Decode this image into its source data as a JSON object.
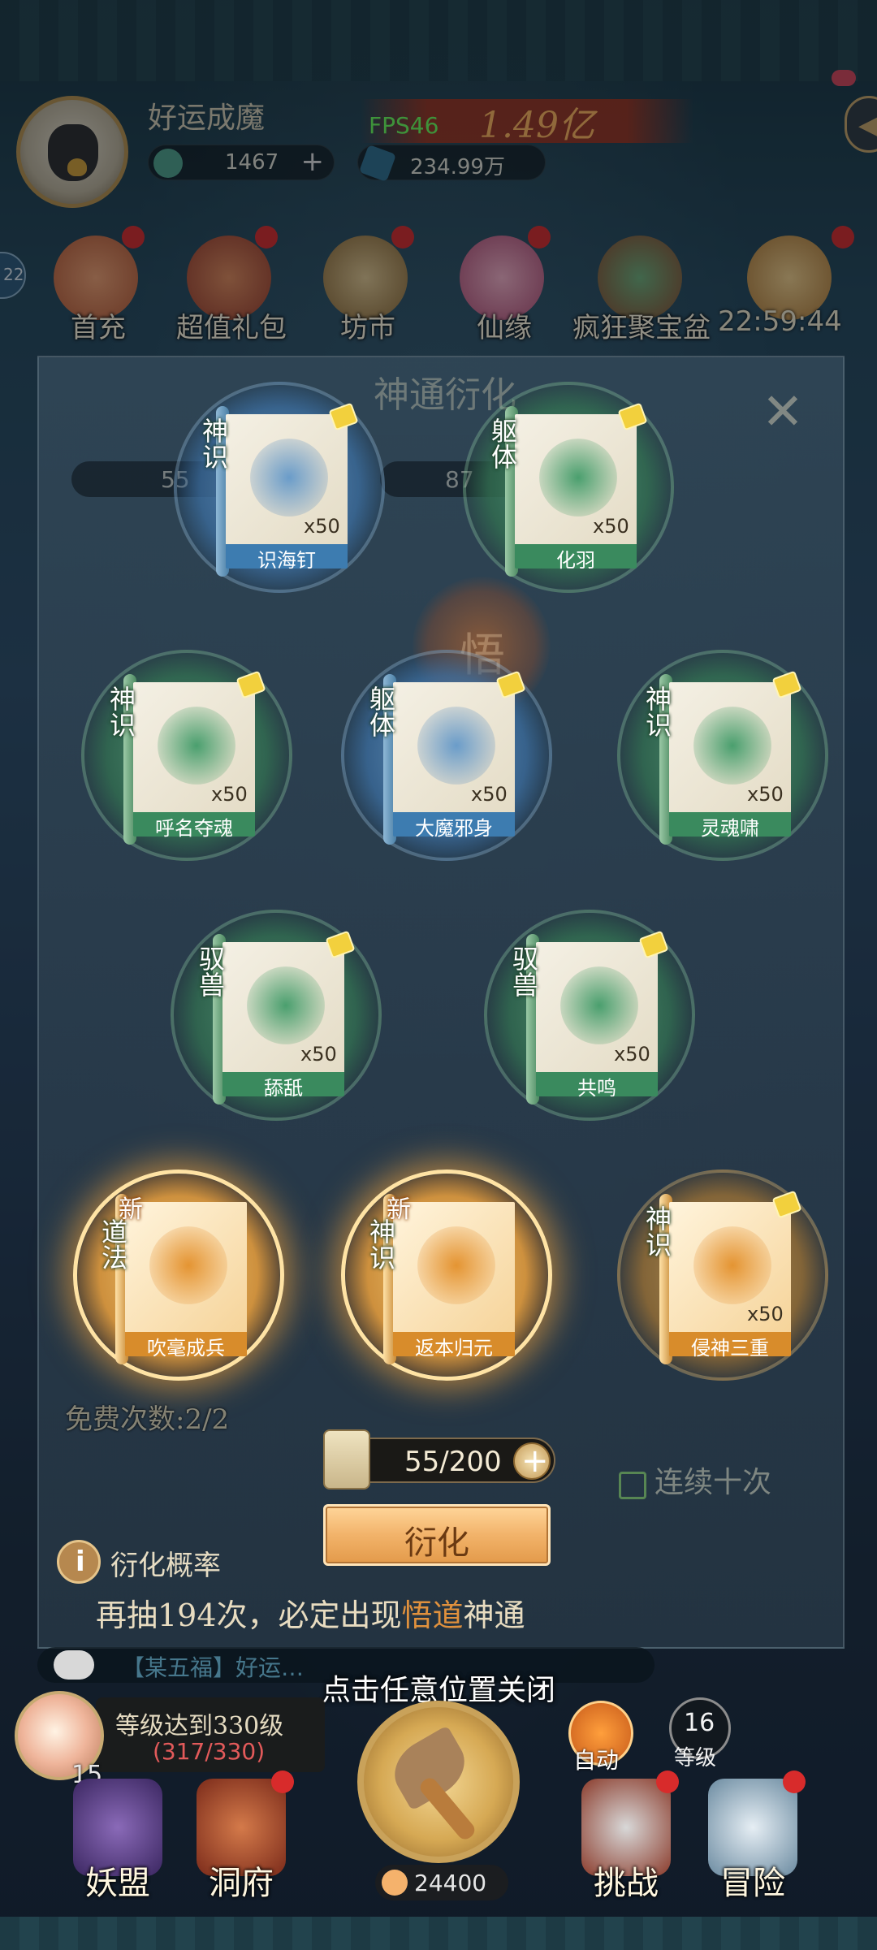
{
  "header": {
    "player_name": "好运成魔",
    "fps": "FPS46",
    "power": "1.49亿",
    "jade": "1467",
    "spirit_stone": "234.99万",
    "side_badge": "22"
  },
  "events": [
    {
      "label": "首充",
      "icon": "first-recharge-icon",
      "color": "#d8764a"
    },
    {
      "label": "超值礼包",
      "icon": "gift-bag-icon",
      "color": "#c45a3c"
    },
    {
      "label": "坊市",
      "icon": "market-coin-icon",
      "color": "#b48f4e"
    },
    {
      "label": "仙缘",
      "icon": "lotus-icon",
      "color": "#d9708f"
    },
    {
      "label": "疯狂聚宝盆",
      "icon": "treasure-bowl-icon",
      "color": "#b7603a"
    }
  ],
  "event_timer": "22:59:44",
  "panel": {
    "title": "神通衍化",
    "bg_res_1": "55",
    "bg_res_2": "87",
    "bg_orb_char": "悟",
    "free_count": "免费次数:2/2",
    "scroll_count": "55/200",
    "ten_times_label": "连续十次",
    "derive_button": "衍化",
    "probability_label": "衍化概率",
    "pity_prefix": "再抽194次，必定出现",
    "pity_highlight": "悟道",
    "pity_suffix": "神通"
  },
  "cards": [
    {
      "name": "识海钉",
      "type": "神识",
      "qty": "x50",
      "color": "blue",
      "is_new": false
    },
    {
      "name": "化羽",
      "type": "躯体",
      "qty": "x50",
      "color": "green",
      "is_new": false
    },
    {
      "name": "呼名夺魂",
      "type": "神识",
      "qty": "x50",
      "color": "green",
      "is_new": false
    },
    {
      "name": "大魔邪身",
      "type": "躯体",
      "qty": "x50",
      "color": "blue",
      "is_new": false
    },
    {
      "name": "灵魂啸",
      "type": "神识",
      "qty": "x50",
      "color": "green",
      "is_new": false
    },
    {
      "name": "舔舐",
      "type": "驭兽",
      "qty": "x50",
      "color": "green",
      "is_new": false
    },
    {
      "name": "共鸣",
      "type": "驭兽",
      "qty": "x50",
      "color": "green",
      "is_new": false
    },
    {
      "name": "吹毫成兵",
      "type": "道法",
      "qty": "",
      "color": "gold",
      "is_new": true,
      "new_label": "新"
    },
    {
      "name": "返本归元",
      "type": "神识",
      "qty": "",
      "color": "gold",
      "is_new": true,
      "new_label": "新"
    },
    {
      "name": "侵神三重",
      "type": "神识",
      "qty": "x50",
      "color": "gold-dim",
      "is_new": false
    }
  ],
  "chat": "【某五福】好运…",
  "close_hint": "点击任意位置关闭",
  "bottom": {
    "quest_title": "等级达到330级",
    "quest_progress": "(317/330)",
    "peach_count": "15",
    "auto_label": "自动",
    "level_num": "16",
    "level_label": "等级",
    "coin": "24400"
  },
  "nav": [
    {
      "label": "妖盟",
      "icon": "demon-alliance-icon",
      "color": "#5b3f86"
    },
    {
      "label": "洞府",
      "icon": "cave-house-icon",
      "color": "#b04a2c"
    },
    {
      "label": "挑战",
      "icon": "challenge-icon",
      "color": "#a93a2c"
    },
    {
      "label": "冒险",
      "icon": "adventure-icon",
      "color": "#8fa6b8"
    }
  ]
}
